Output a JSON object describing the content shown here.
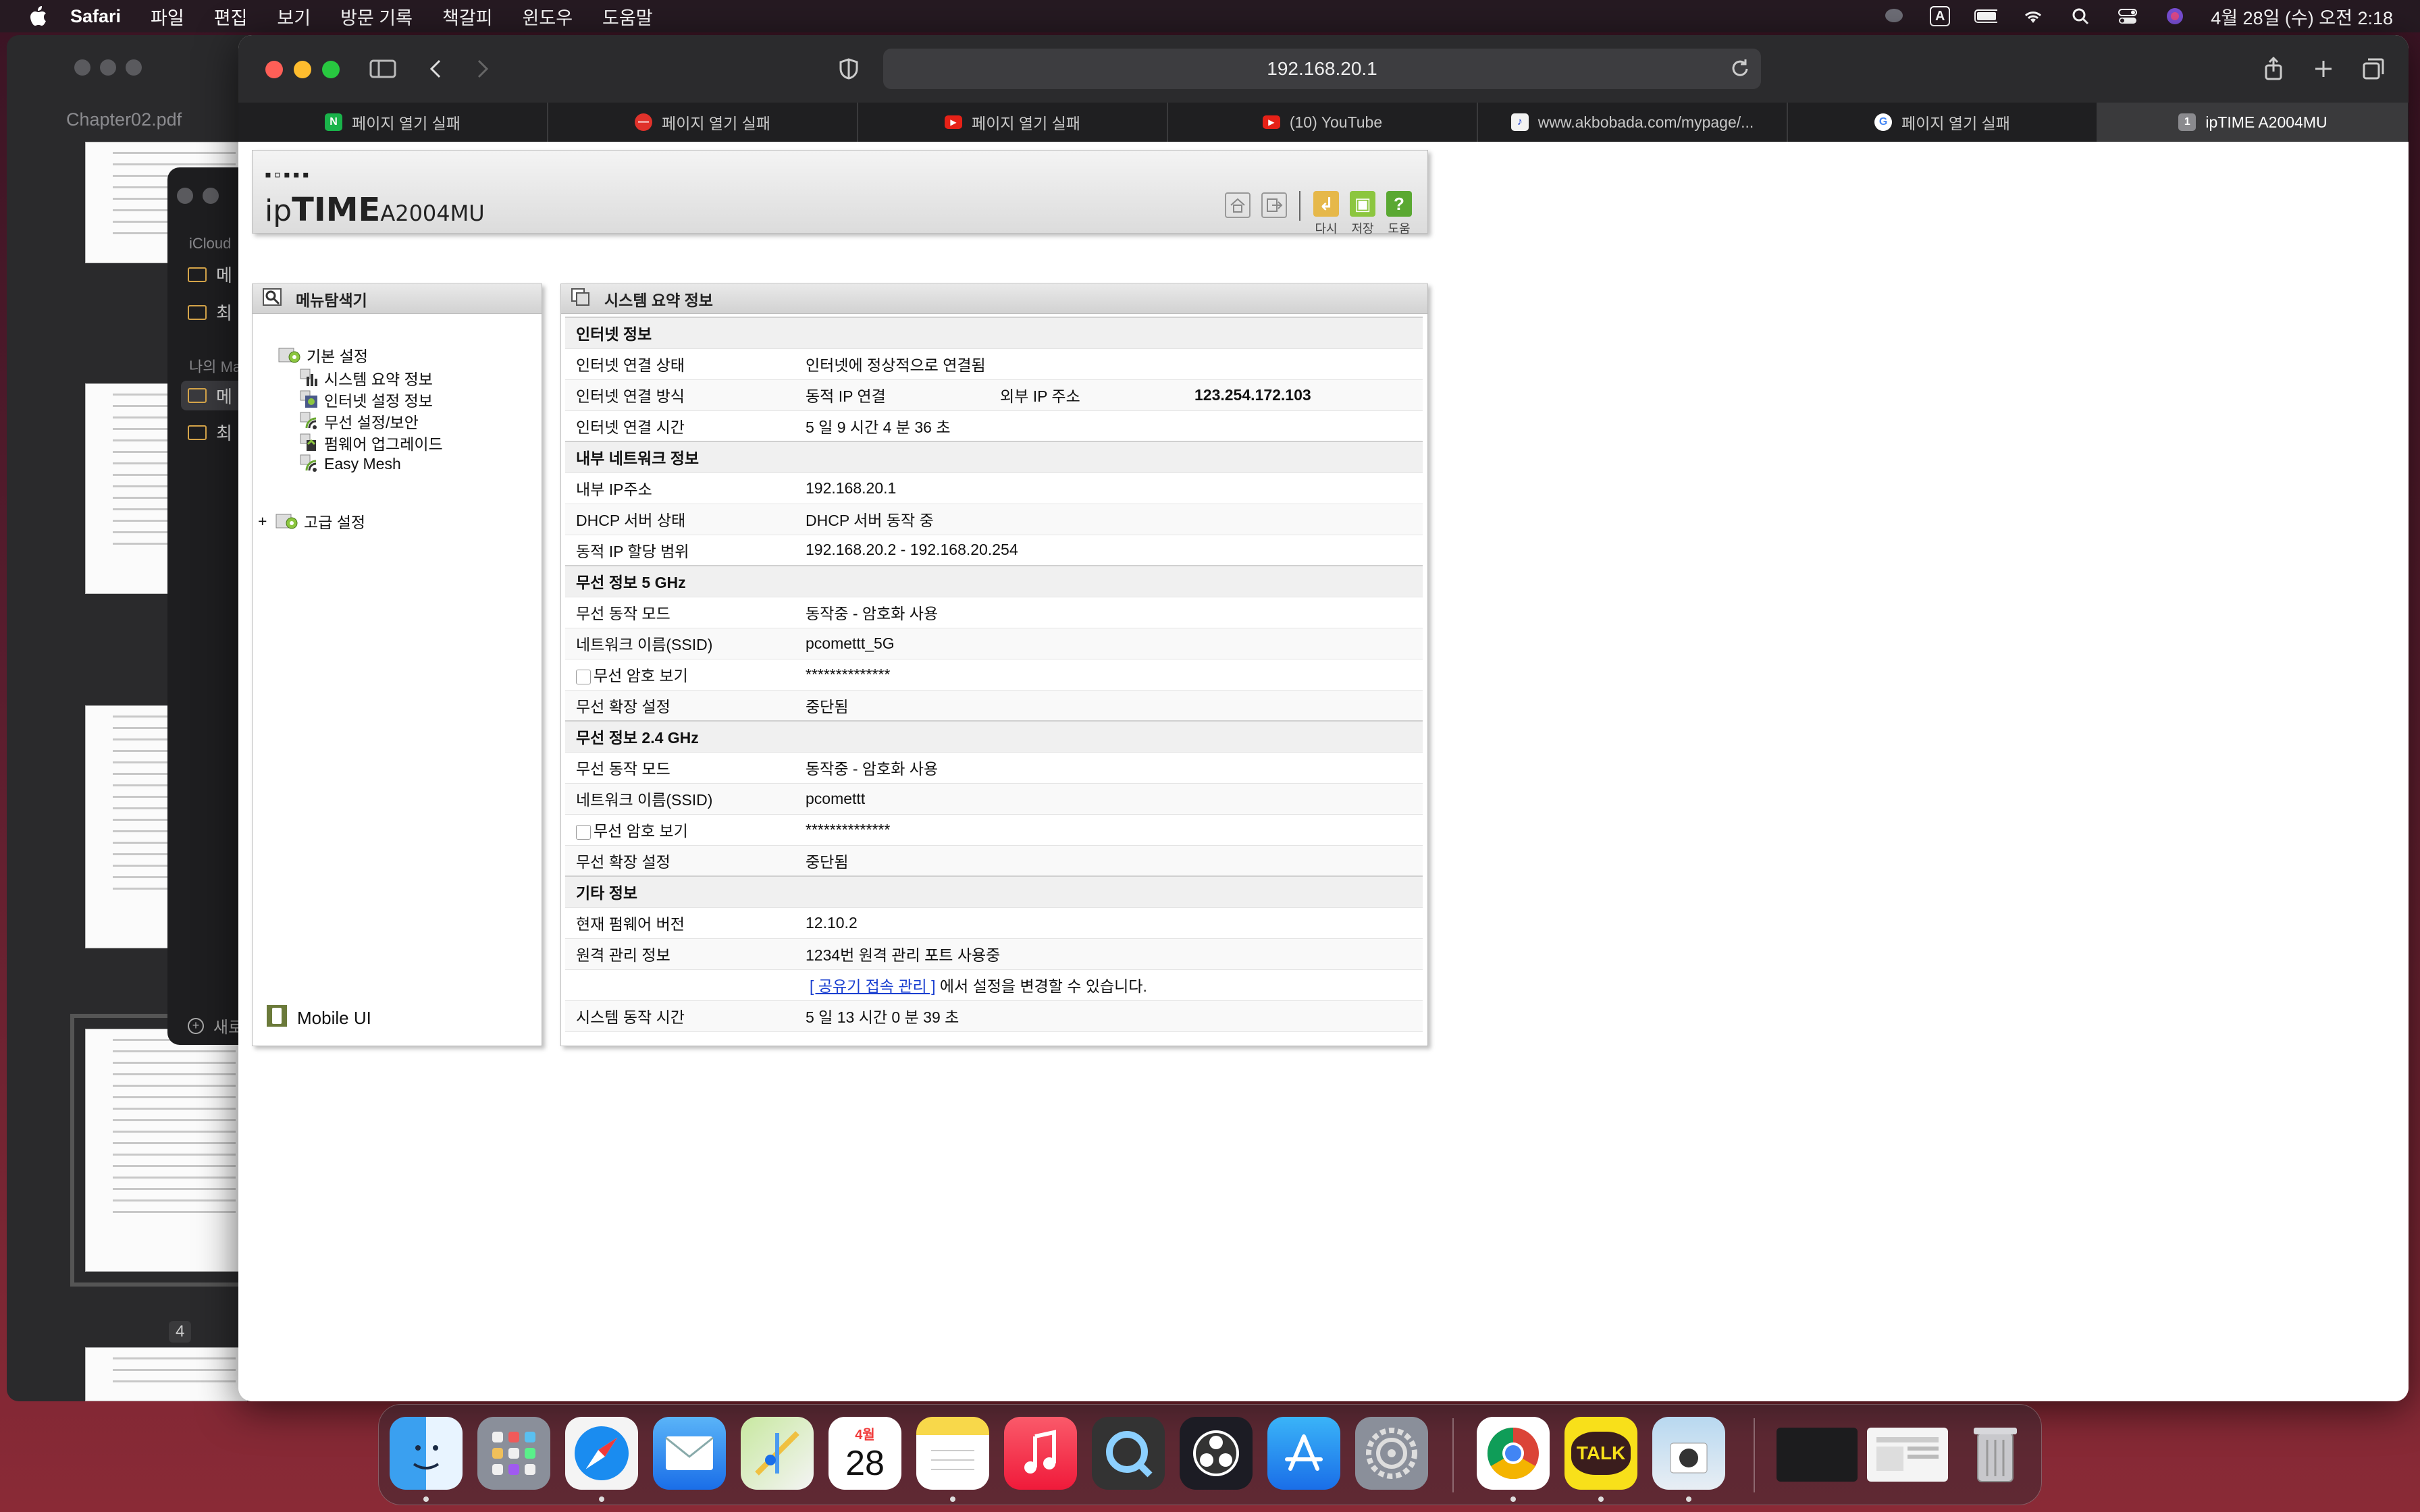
{
  "menubar": {
    "app_name": "Safari",
    "items": [
      "파일",
      "편집",
      "보기",
      "방문 기록",
      "책갈피",
      "윈도우",
      "도움말"
    ],
    "input_indicator": "A",
    "datetime": "4월 28일 (수) 오전 2:18"
  },
  "background_windows": {
    "pdf_title": "Chapter02.pdf",
    "pdf_page_number": "4",
    "icloud_label": "iCloud",
    "my_mac_label": "나의 Mac",
    "icloud_rows": [
      "메",
      "최"
    ],
    "mac_rows": [
      "메",
      "최"
    ],
    "new_folder": "새로"
  },
  "browser": {
    "url": "192.168.20.1",
    "tabs": [
      {
        "label": "페이지 열기 실패",
        "icon": "naver-favicon",
        "color": "#19b34a",
        "glyph": "N"
      },
      {
        "label": "페이지 열기 실패",
        "icon": "blocked-favicon",
        "color": "#e0322b",
        "glyph": "—"
      },
      {
        "label": "페이지 열기 실패",
        "icon": "youtube-favicon",
        "color": "#e62117",
        "glyph": "▶"
      },
      {
        "label": "(10) YouTube",
        "icon": "youtube-favicon",
        "color": "#e62117",
        "glyph": "▶"
      },
      {
        "label": "www.akbobada.com/mypage/...",
        "icon": "akbobada-favicon",
        "color": "#f2f2f2",
        "glyph": "♪"
      },
      {
        "label": "페이지 열기 실패",
        "icon": "google-favicon",
        "color": "#ffffff",
        "glyph": "G"
      },
      {
        "label": "ipTIME A2004MU",
        "icon": "iptime-favicon",
        "color": "#8a8a8e",
        "glyph": "1",
        "active": true
      }
    ]
  },
  "iptime": {
    "logo": {
      "brand_a": "ip",
      "brand_b": "TIME",
      "model": "A2004MU"
    },
    "header_actions": [
      "다시",
      "저장",
      "도움"
    ],
    "menu": {
      "title": "메뉴탐색기",
      "basic": "기본 설정",
      "basic_items": [
        "시스템 요약 정보",
        "인터넷 설정 정보",
        "무선 설정/보안",
        "펌웨어 업그레이드",
        "Easy Mesh"
      ],
      "advanced_marker": "+",
      "advanced": "고급 설정",
      "mobile_ui": "Mobile UI"
    },
    "summary": {
      "title": "시스템 요약 정보",
      "internet": {
        "heading": "인터넷 정보",
        "status_label": "인터넷 연결 상태",
        "status": "인터넷에 정상적으로 연결됨",
        "method_label": "인터넷 연결 방식",
        "method": "동적 IP 연결",
        "ext_ip_label": "외부 IP 주소",
        "ext_ip": "123.254.172.103",
        "time_label": "인터넷 연결 시간",
        "time": "5 일 9 시간 4 분 36 초"
      },
      "lan": {
        "heading": "내부 네트워크 정보",
        "ip_label": "내부 IP주소",
        "ip": "192.168.20.1",
        "dhcp_label": "DHCP 서버 상태",
        "dhcp": "DHCP 서버 동작 중",
        "range_label": "동적 IP 할당 범위",
        "range": "192.168.20.2 -  192.168.20.254"
      },
      "wifi5": {
        "heading": "무선 정보 5 GHz",
        "mode_label": "무선 동작 모드",
        "mode": "동작중 - 암호화 사용",
        "ssid_label": "네트워크 이름(SSID)",
        "ssid": "pcomettt_5G",
        "pw_label": "무선 암호 보기",
        "pw": "**************",
        "ext_label": "무선 확장 설정",
        "ext": "중단됨"
      },
      "wifi24": {
        "heading": "무선 정보 2.4 GHz",
        "mode_label": "무선 동작 모드",
        "mode": "동작중 - 암호화 사용",
        "ssid_label": "네트워크 이름(SSID)",
        "ssid": "pcomettt",
        "pw_label": "무선 암호 보기",
        "pw": "**************",
        "ext_label": "무선 확장 설정",
        "ext": "중단됨"
      },
      "other": {
        "heading": "기타 정보",
        "fw_label": "현재 펌웨어 버전",
        "fw": "12.10.2",
        "remote_label": "원격 관리 정보",
        "remote": "1234번 원격 관리 포트 사용중",
        "remote_link": "[ 공유기 접속 관리 ]",
        "remote_note": " 에서 설정을 변경할 수 있습니다.",
        "uptime_label": "시스템 동작 시간",
        "uptime": "5 일 13 시간 0 분 39 초"
      }
    }
  },
  "dock": {
    "calendar_month": "4월",
    "calendar_day": "28",
    "kakao_label": "TALK",
    "apps": [
      "finder",
      "launchpad",
      "safari",
      "mail",
      "maps",
      "calendar",
      "notes",
      "music",
      "quicktime",
      "obs",
      "app-store",
      "system-preferences",
      "chrome",
      "kakaotalk",
      "preview",
      "window-1",
      "window-2",
      "trash"
    ]
  }
}
